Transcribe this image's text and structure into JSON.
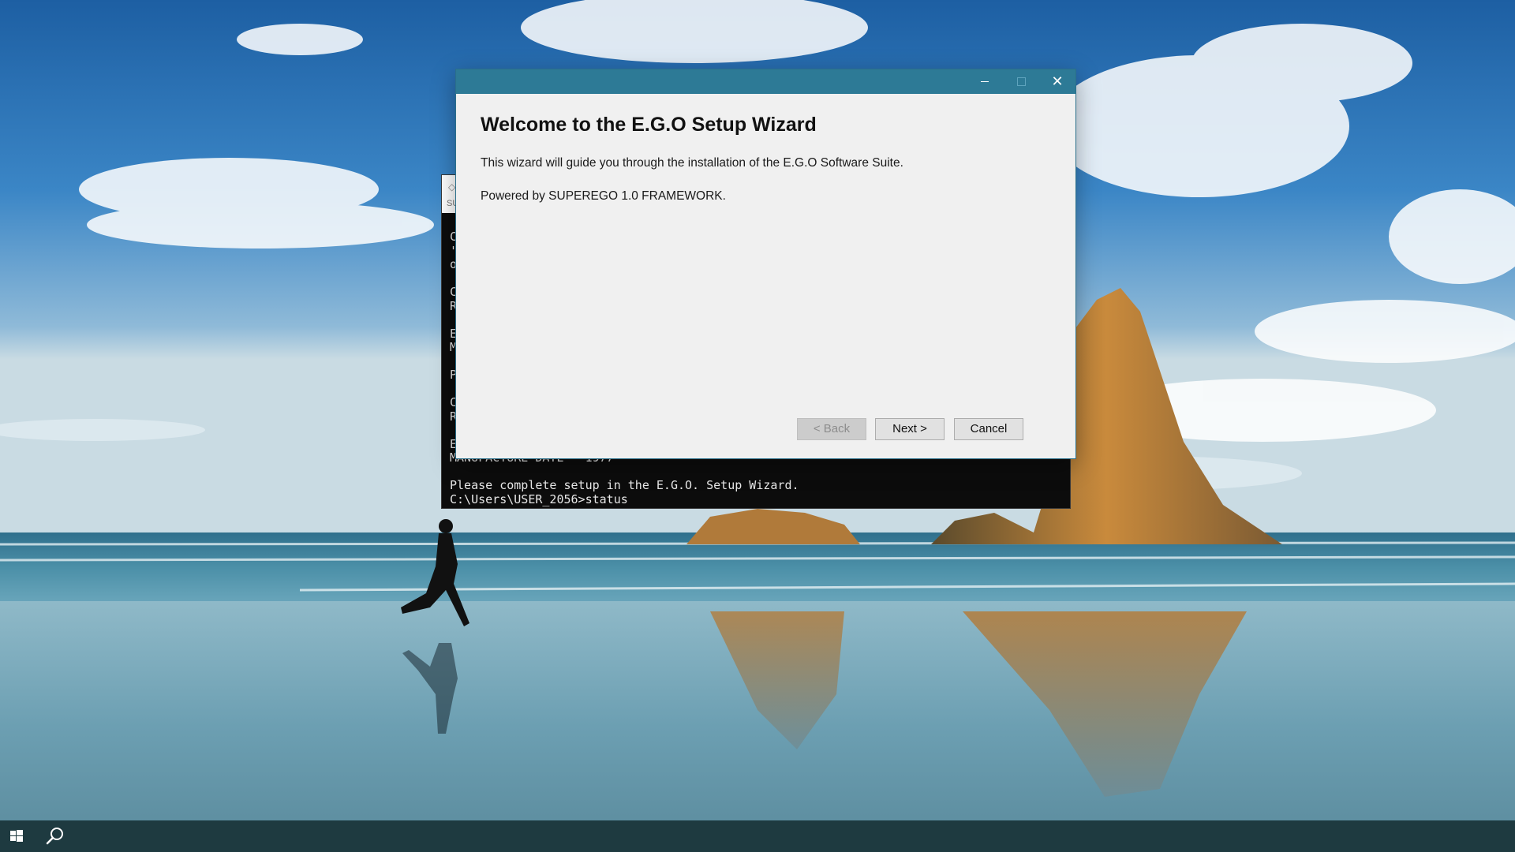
{
  "wizard": {
    "heading": "Welcome to the E.G.O Setup Wizard",
    "description": "This wizard will guide you through the installation of the E.G.O Software Suite.",
    "powered_by": "Powered by SUPEREGO 1.0 FRAMEWORK.",
    "buttons": {
      "back": "< Back",
      "next": "Next >",
      "cancel": "Cancel"
    },
    "titlebar_color": "#2d7a96"
  },
  "console": {
    "title_fragment": "SU",
    "lines": [
      "C",
      "'",
      "o",
      "",
      "C",
      "R",
      "",
      "E",
      "M",
      "",
      "P",
      "",
      "C",
      "R",
      "",
      "E",
      "MANUFACTURE DATE - 1977",
      "",
      "Please complete setup in the E.G.O. Setup Wizard.",
      "C:\\Users\\USER_2056>status"
    ]
  },
  "taskbar": {
    "start_icon": "windows-logo-icon",
    "search_icon": "search-icon",
    "color": "#1e3a40"
  }
}
